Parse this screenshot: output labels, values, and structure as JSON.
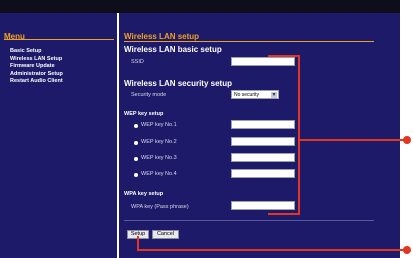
{
  "menu": {
    "title": "Menu",
    "items": [
      "Basic Setup",
      "Wireless LAN Setup",
      "Firmware Update",
      "Administrator Setup",
      "Restart Audio Client"
    ]
  },
  "page_title": "Wireless LAN setup",
  "basic": {
    "heading": "Wireless LAN basic setup",
    "ssid_label": "SSID",
    "ssid_value": ""
  },
  "security": {
    "heading": "Wireless LAN security setup",
    "mode_label": "Security mode",
    "mode_value": "No security"
  },
  "wep": {
    "heading": "WEP key setup",
    "keys": [
      "WEP key No.1",
      "WEP key No.2",
      "WEP key No.3",
      "WEP key No.4"
    ]
  },
  "wpa": {
    "heading": "WPA key setup",
    "key_label": "WPA key (Pass phrase)"
  },
  "buttons": {
    "setup": "Setup",
    "cancel": "Cancel"
  },
  "colors": {
    "accent": "#f0a020",
    "panel": "#1d1a6a",
    "callout": "#e5341f"
  }
}
